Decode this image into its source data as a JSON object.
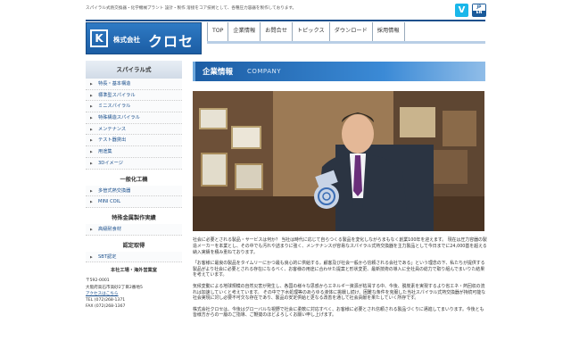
{
  "header": {
    "tagline": "スパイラル式熱交換器・化学機械プラント 設計・製作 溶接をコア技術として、各種圧力容器を製作しております。",
    "social": {
      "vimeo_label": "V",
      "jp_label": "JP",
      "en_label": "EN"
    },
    "logo": {
      "mark": "K",
      "sub": "株式会社",
      "name": "クロセ"
    }
  },
  "nav": [
    {
      "label": "TOP"
    },
    {
      "label": "企業情報"
    },
    {
      "label": "お問合せ"
    },
    {
      "label": "トピックス"
    },
    {
      "label": "ダウンロード"
    },
    {
      "label": "採用情報"
    }
  ],
  "sidebar": {
    "spiral_heading": "スパイラル式",
    "spiral_items": [
      {
        "label": "特長・基本構造"
      },
      {
        "label": "標準型スパイラル"
      },
      {
        "label": "ミニスパイラル"
      },
      {
        "label": "特殊構造スパイラル"
      },
      {
        "label": "メンテナンス"
      },
      {
        "label": "テスト器貸出"
      },
      {
        "label": "用途集"
      },
      {
        "label": "3Dイメージ"
      }
    ],
    "general_heading": "一般化工機",
    "general_items": [
      {
        "label": "多管式熱交換器"
      },
      {
        "label": "MINI COIL"
      }
    ],
    "special_heading": "特殊金属製作実績",
    "special_items": [
      {
        "label": "高級耐食材"
      }
    ],
    "cert_heading": "認定取得",
    "cert_items": [
      {
        "label": "SBT認定"
      }
    ],
    "address": {
      "hq": "本社工場・海外営業室",
      "zip": "〒592-0001",
      "street": "大阪府高石市高砂2丁目2番地5",
      "access": "アクセスはこちら",
      "tel": "TEL (072)268-1371",
      "fax": "FAX (072)268-1367"
    }
  },
  "main": {
    "banner_jp": "企業情報",
    "banner_en": "COMPANY",
    "paragraphs": [
      "社会に必要とされる製品・サービスは何か？ 当社は時代に応じて自らつくる製品を変化しながらまもなく創業100年を迎えます。 現在は圧力容器の製造メーカーを本業とし、その中でも汚れや詰まりに強く、メンテナンスが容易なスパイラル式熱交換器を主力製品として今日までに24,000基を超える納入実績を積み重ねております。",
      "「お客様に最良の製品をタイムリーにかつ最も良心的に供給する。顧客及び社会一般から信頼される会社である」という理念の下、私たちが提供する製品がより社会に必要とされる存在になるべく、お客様の用途に合わせた提案と形状変更、最新技術の導入に全社員の総力で取り組んでまいりた結果を考えています。",
      "気候変動による地球規模の自然災害が発生し、各国の様々な思惑からエネルギー資源が枯渇する中、今後、脱炭素を実現するより省エネ・熱回収の流れは加速していくと考えています。 その中で下水処理等のあらゆる液体に挑戦し続け、困難な条件を克服した当社スパイラル式熱交換器が持続可能な社会実現に対し必要不可欠な存在であり、製品の安定供給と更なる改善を通して社会貢献を果たしていく所存です。",
      "株式会社クロセは、今後はグローバルな視野で社会に柔軟に対応すべく、お客様に必要とされ信頼される製品づくりに邁進してまいります。今後とも皆様方からの一層のご指導、ご鞭撻のほどよろしくお願い申し上げます。"
    ]
  },
  "colors": {
    "brand_blue": "#1c5da4",
    "link_blue": "#1a4f8c",
    "vimeo": "#1ab7ea"
  }
}
